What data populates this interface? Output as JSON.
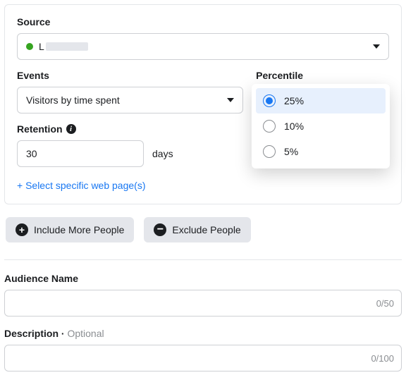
{
  "panel": {
    "sourceLabel": "Source",
    "sourceLetter": "L",
    "eventsLabel": "Events",
    "eventsValue": "Visitors by time spent",
    "percentileLabel": "Percentile",
    "percentileValue": "25%",
    "retentionLabel": "Retention",
    "retentionValue": "30",
    "daysLabel": "days",
    "linkText": "+ Select specific web page(s)"
  },
  "dropdown": {
    "options": [
      {
        "label": "25%",
        "selected": true
      },
      {
        "label": "10%",
        "selected": false
      },
      {
        "label": "5%",
        "selected": false
      }
    ]
  },
  "actions": {
    "includeLabel": "Include More People",
    "excludeLabel": "Exclude People"
  },
  "audienceName": {
    "label": "Audience Name",
    "value": "",
    "counter": "0/50"
  },
  "description": {
    "label": "Description",
    "optional": "Optional",
    "value": "",
    "counter": "0/100"
  }
}
